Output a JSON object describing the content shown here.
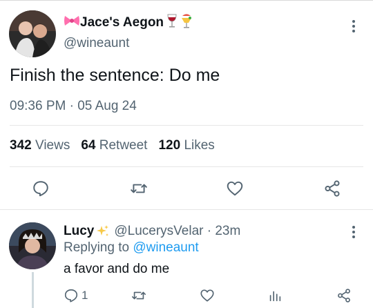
{
  "tweet": {
    "display_name": "Jace's Aegon",
    "handle": "@wineaunt",
    "text": "Finish the sentence: Do me",
    "timestamp": "09:36 PM · 05 Aug 24",
    "stats": {
      "views_count": "342",
      "views_label": "Views",
      "retweets_count": "64",
      "retweets_label": "Retweet",
      "likes_count": "120",
      "likes_label": "Likes"
    },
    "actions": [
      "reply-icon",
      "retweet-icon",
      "like-icon",
      "share-icon"
    ]
  },
  "reply": {
    "display_name": "Lucy",
    "handle_time": "@LucerysVelar · 23m",
    "replying_prefix": "Replying to",
    "replying_to": "@wineaunt",
    "text": "a favor and do me",
    "reply_count": "1",
    "actions": [
      "reply-icon",
      "retweet-icon",
      "like-icon",
      "views-icon",
      "share-icon"
    ]
  },
  "colors": {
    "text_primary": "#0f1419",
    "text_secondary": "#536471",
    "link": "#1d9bf0",
    "divider": "#e6e6e6"
  }
}
